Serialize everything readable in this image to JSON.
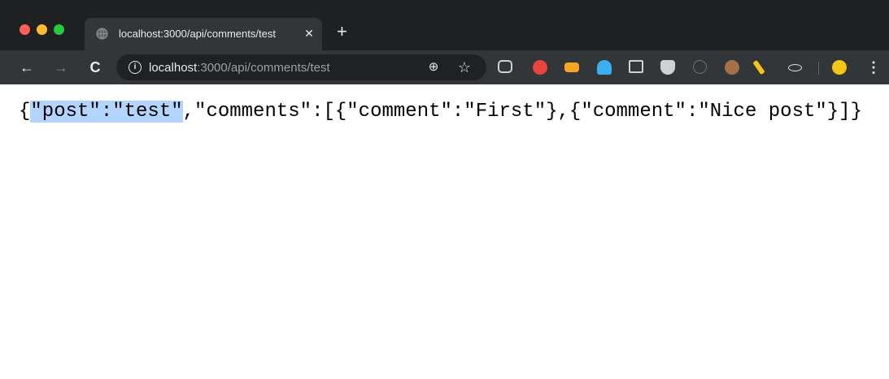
{
  "tab": {
    "title": "localhost:3000/api/comments/test",
    "close_icon": "close-icon",
    "new_tab_icon": "plus-icon"
  },
  "toolbar": {
    "back": "←",
    "forward": "→",
    "reload": "C",
    "url_host": "localhost",
    "url_rest": ":3000/api/comments/test",
    "zoom_icon": "⊕",
    "star_icon": "☆",
    "menu_icon": "⋮"
  },
  "content": {
    "selected_text": "\"post\":\"test\"",
    "json_rest": ",\"comments\":[{\"comment\":\"First\"},{\"comment\":\"Nice post\"}]}",
    "json_open": "{"
  },
  "colors": {
    "titlebar": "#1f2022",
    "toolbar": "#323639",
    "selection": "#b3d4fc"
  }
}
